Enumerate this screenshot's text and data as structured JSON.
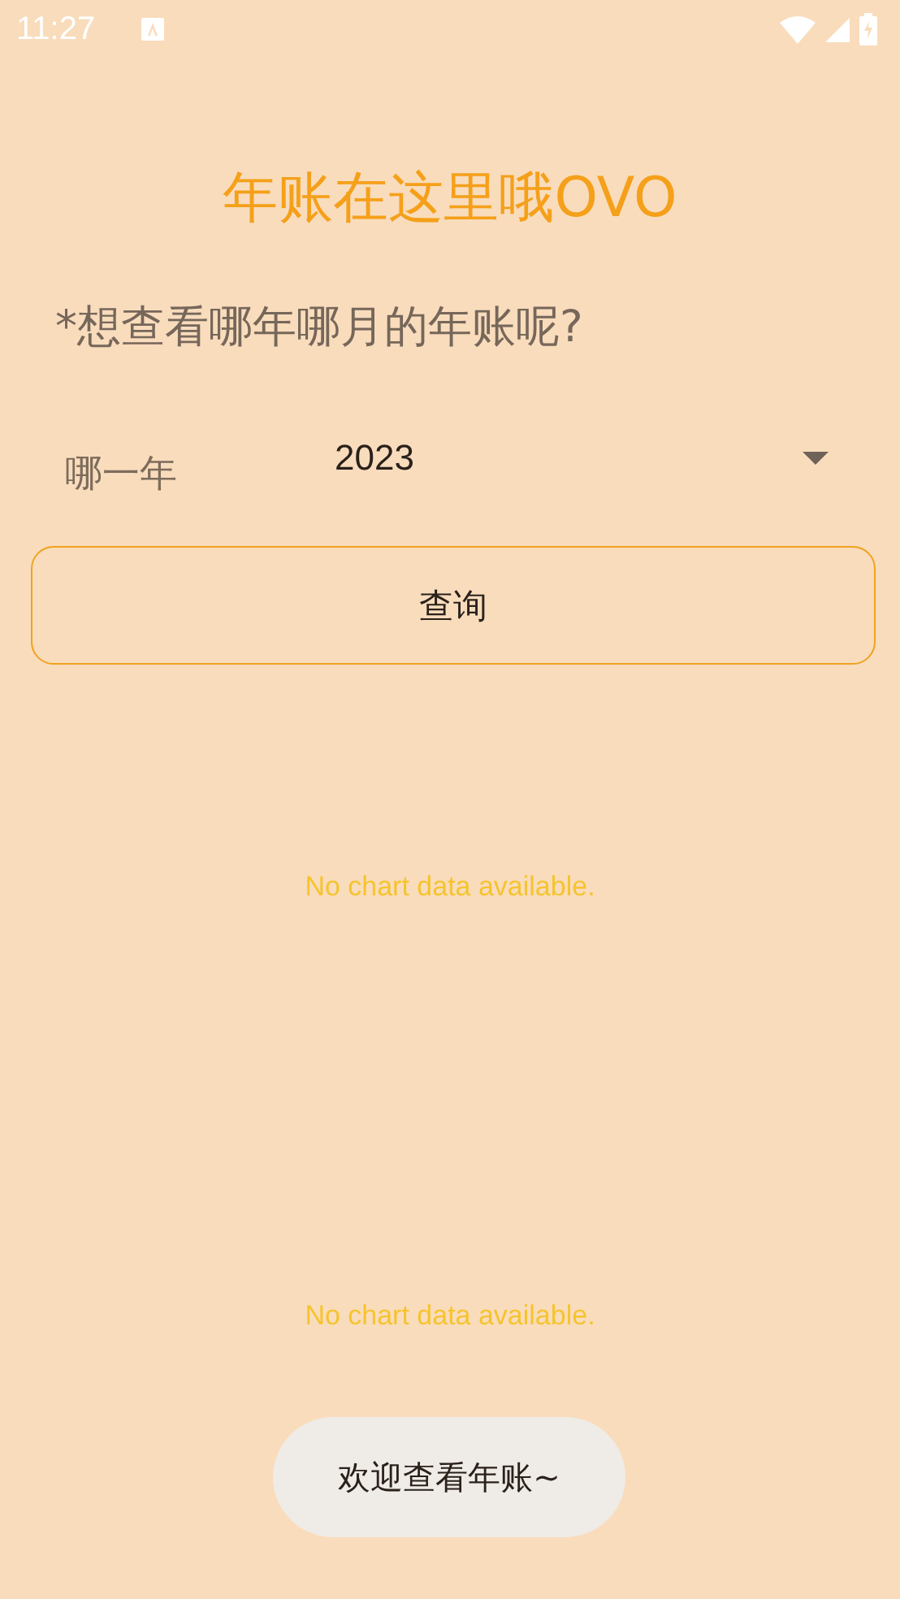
{
  "status_bar": {
    "time": "11:27"
  },
  "title": "年账在这里哦OVO",
  "question": "*想查看哪年哪月的年账呢?",
  "year_picker": {
    "label": "哪一年",
    "value": "2023"
  },
  "query_button": "查询",
  "charts": [
    {
      "empty_text": "No chart data available."
    },
    {
      "empty_text": "No chart data available."
    }
  ],
  "toast": "欢迎查看年账~"
}
